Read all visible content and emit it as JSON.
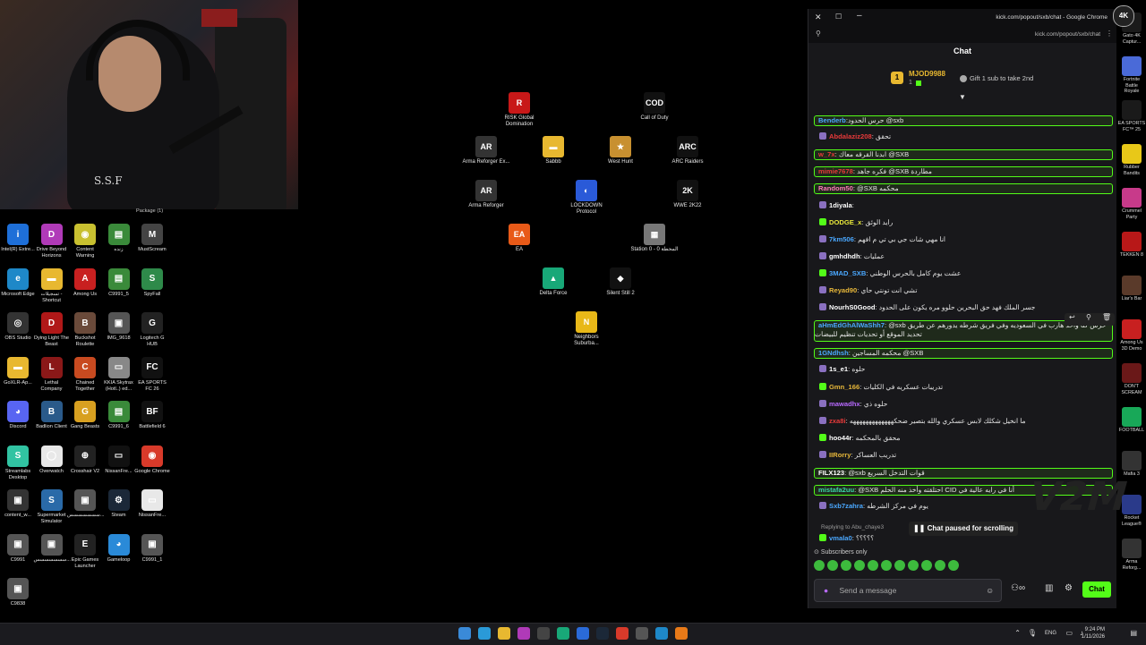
{
  "webcam": {
    "shirt_text": "S.S.F"
  },
  "desktop": {
    "package_label": "Package (1)",
    "icons": [
      {
        "label": "Intel(R) Extre...",
        "color": "#1e6fd8",
        "glyph": "i"
      },
      {
        "label": "Drive Beyond Horizons",
        "color": "#b03ab8",
        "glyph": "D"
      },
      {
        "label": "Content Warning",
        "color": "#c8c030",
        "glyph": "◉"
      },
      {
        "label": "زنده",
        "color": "#3a8a3a",
        "glyph": "▤"
      },
      {
        "label": "MustScream",
        "color": "#444444",
        "glyph": "M"
      },
      {
        "label": "Microsoft Edge",
        "color": "#1e88c8",
        "glyph": "e"
      },
      {
        "label": "تسجيلات - Shortcut",
        "color": "#e8b830",
        "glyph": "▬"
      },
      {
        "label": "Among Us",
        "color": "#c82020",
        "glyph": "A"
      },
      {
        "label": "C9991_5",
        "color": "#3a8a3a",
        "glyph": "▤"
      },
      {
        "label": "SpyFall",
        "color": "#2e8a4a",
        "glyph": "S"
      },
      {
        "label": "OBS Studio",
        "color": "#333333",
        "glyph": "◎"
      },
      {
        "label": "Dying Light The Beast",
        "color": "#b01818",
        "glyph": "D"
      },
      {
        "label": "Buckshot Roulette",
        "color": "#6a4a3a",
        "glyph": "B"
      },
      {
        "label": "IMG_9618",
        "color": "#555555",
        "glyph": "▣"
      },
      {
        "label": "Logitech G HUB",
        "color": "#222222",
        "glyph": "G"
      },
      {
        "label": "GoXLR-Ap...",
        "color": "#e8b830",
        "glyph": "▬"
      },
      {
        "label": "Lethal Company",
        "color": "#8a1818",
        "glyph": "L"
      },
      {
        "label": "Chained Together",
        "color": "#c84a20",
        "glyph": "C"
      },
      {
        "label": "KKIA Skytrax (Hotl..) ed...",
        "color": "#888888",
        "glyph": "▭"
      },
      {
        "label": "EA SPORTS FC 26",
        "color": "#111111",
        "glyph": "FC"
      },
      {
        "label": "Discord",
        "color": "#5865f2",
        "glyph": "◕"
      },
      {
        "label": "Badlion Client",
        "color": "#2a5a8a",
        "glyph": "B"
      },
      {
        "label": "Gang Beasts",
        "color": "#d8a020",
        "glyph": "G"
      },
      {
        "label": "C9991_6",
        "color": "#3a8a3a",
        "glyph": "▤"
      },
      {
        "label": "Battlefield 6",
        "color": "#111111",
        "glyph": "BF"
      },
      {
        "label": "Streamlabs Desktop",
        "color": "#31c3a2",
        "glyph": "S"
      },
      {
        "label": "Overwatch",
        "color": "#e8e8e8",
        "glyph": "◯"
      },
      {
        "label": "Crosshair V2",
        "color": "#222222",
        "glyph": "⊕"
      },
      {
        "label": "NissanFre...",
        "color": "#111111",
        "glyph": "▭"
      },
      {
        "label": "Google Chrome",
        "color": "#d83a2a",
        "glyph": "◉"
      },
      {
        "label": "content_w...",
        "color": "#333333",
        "glyph": "▣"
      },
      {
        "label": "Supermarket Simulator",
        "color": "#2a6aa8",
        "glyph": "S"
      },
      {
        "label": "سسسسسسس...",
        "color": "#555555",
        "glyph": "▣"
      },
      {
        "label": "Steam",
        "color": "#1b2838",
        "glyph": "⚙"
      },
      {
        "label": "NissanFre...",
        "color": "#e8e8e8",
        "glyph": "▭"
      },
      {
        "label": "C9991",
        "color": "#555555",
        "glyph": "▣"
      },
      {
        "label": "سسسسسسس...",
        "color": "#555555",
        "glyph": "▣"
      },
      {
        "label": "Epic Games Launcher",
        "color": "#222222",
        "glyph": "E"
      },
      {
        "label": "Gameloop",
        "color": "#2a8ad8",
        "glyph": "◕"
      },
      {
        "label": "C9991_1",
        "color": "#555555",
        "glyph": "▣"
      },
      {
        "label": "C9838",
        "color": "#555555",
        "glyph": "▣"
      }
    ],
    "center_icons": [
      {
        "label": "RISK Global Domination",
        "color": "#c81818",
        "glyph": "R"
      },
      {
        "label": "Call of Duty",
        "color": "#111111",
        "glyph": "COD"
      },
      {
        "label": "Arma Reforger Ex...",
        "color": "#333333",
        "glyph": "AR"
      },
      {
        "label": "Sabbb",
        "color": "#e8b830",
        "glyph": "▬"
      },
      {
        "label": "West Hunt",
        "color": "#c89030",
        "glyph": "★"
      },
      {
        "label": "ARC Raiders",
        "color": "#111111",
        "glyph": "ARC"
      },
      {
        "label": "Arma Reforger",
        "color": "#333333",
        "glyph": "AR"
      },
      {
        "label": "LOCKDOWN Protocol",
        "color": "#2a5ad8",
        "glyph": "◐"
      },
      {
        "label": "WWE 2K22",
        "color": "#111111",
        "glyph": "2K"
      },
      {
        "label": "EA",
        "color": "#e85a18",
        "glyph": "EA"
      },
      {
        "label": "Station 0 - المحطة 0",
        "color": "#777777",
        "glyph": "▦"
      },
      {
        "label": "Delta Force",
        "color": "#18a878",
        "glyph": "▲"
      },
      {
        "label": "Silent Still 2",
        "color": "#111111",
        "glyph": "◆"
      },
      {
        "label": "Neighbors Suburba...",
        "color": "#e8b818",
        "glyph": "N"
      }
    ]
  },
  "chat": {
    "window_url_title": "kick.com/popout/sxb/chat - Google Chrome",
    "url": "kick.com/popout/sxb/chat",
    "title": "Chat",
    "leader": {
      "rank": "1",
      "name": "MJOD9988",
      "count": "1",
      "gift_text": "Gift 1 sub to take 2nd"
    },
    "messages": [
      {
        "user": "Benderb",
        "text": ":حرس الحدود @sxb",
        "color": "#4aa8ff",
        "hl": true
      },
      {
        "user": "Abdalaziz208",
        "text": ": تحقق",
        "color": "#e83a3a",
        "hl": false
      },
      {
        "user": "w_7x",
        "text": ": ابدنا القرقه معاك @SXB",
        "color": "#e83a3a",
        "hl": true
      },
      {
        "user": "mimie7678",
        "text": ": فكره جاهد @SXB مطاردة",
        "color": "#e83a3a",
        "hl": true
      },
      {
        "user": "Random50",
        "text": ": @SXB محكمه",
        "color": "#ff7ab8",
        "hl": true
      },
      {
        "user": "1diyala",
        "text": ":",
        "color": "#ffffff",
        "hl": false
      },
      {
        "user": "DODGE_x",
        "text": ": رايد الوئق",
        "color": "#e8e83a",
        "hl": false
      },
      {
        "user": "7km506",
        "text": ": انا مهي شات جي بي تي م افهم",
        "color": "#4aa8ff",
        "hl": false
      },
      {
        "user": "gmhdhdh",
        "text": ": عمليات",
        "color": "#ffffff",
        "hl": false
      },
      {
        "user": "3MAD_SXB",
        "text": ": عشت يوم كامل بالحرس الوطني",
        "color": "#4aa8ff",
        "hl": false
      },
      {
        "user": "Reyad90",
        "text": ": تشي انت تونتي حاي",
        "color": "#e8b83a",
        "hl": false
      },
      {
        "user": "NourhS0Good",
        "text": ": جسر الملك فهد حق البحرين حلوو مره يكون على الحدود",
        "color": "#ffffff",
        "hl": false
      },
      {
        "user": "aHmEdGhAlWaShh7",
        "text": ": @sxb حرس كنا واحد هارب في السعوديه وفي فريق شرطه يدورهم عن طريق تحديد الموقع أو تحديات تنظيم للبيضات",
        "color": "#4aa8ff",
        "hl": true
      },
      {
        "user": "1GNdhsh",
        "text": ": محكمه المساجين @SXB",
        "color": "#4aa8ff",
        "hl": true
      },
      {
        "user": "1s_e1",
        "text": ": حلوه",
        "color": "#ffffff",
        "hl": false
      },
      {
        "user": "Gmn_166",
        "text": ": تدريبات عسكريه في الكليات",
        "color": "#e8b83a",
        "hl": false
      },
      {
        "user": "mawadhx",
        "text": ": حلوه ذي",
        "color": "#b86aff",
        "hl": false
      },
      {
        "user": "zxa8i",
        "text": ": ما انخيل شكلك لابس عسكري والله بتصير ضحكهههههههههههههه",
        "color": "#e83a3a",
        "hl": false
      },
      {
        "user": "hoo44r",
        "text": ": محقق بالمحكمه",
        "color": "#ffffff",
        "hl": false
      },
      {
        "user": "IIRorry",
        "text": ": تدريب العساكر",
        "color": "#e8b83a",
        "hl": false
      },
      {
        "user": "FILX123",
        "text": ": @sxb قوات التدخل السريع",
        "color": "#ffffff",
        "hl": true
      },
      {
        "user": "mistafa2uu",
        "text": ": @SXB احتلقته وأخذ منه الحلم CID أنا في رايه عالية في",
        "color": "#3ad8a8",
        "hl": true
      },
      {
        "user": "Sxb7zahra",
        "text": ": يوم في مركز الشرطه",
        "color": "#4aa8ff",
        "hl": false
      }
    ],
    "reply_line": "Replying to Abu_chaye3",
    "last_user": "vmala0",
    "last_text": ": ؟؟؟؟؟",
    "paused_text": "Chat paused for scrolling",
    "subs_only": "Subscribers only",
    "input_placeholder": "Send a message",
    "chat_button": "Chat"
  },
  "right_strip": [
    {
      "label": "Gato 4K Captur...",
      "color": "#1a1a1a"
    },
    {
      "label": "Fortnite Battle Royale",
      "color": "#4a6ad8"
    },
    {
      "label": "EA SPORTS FC™ 25",
      "color": "#1a1a1a"
    },
    {
      "label": "Rubber Bandits",
      "color": "#e8c818"
    },
    {
      "label": "Crummel Party",
      "color": "#c83a8a"
    },
    {
      "label": "TEKKEN 8",
      "color": "#b81818"
    },
    {
      "label": "Liar's Bar",
      "color": "#5a3a2a"
    },
    {
      "label": "Among Us 3D Demo",
      "color": "#c82020"
    },
    {
      "label": "DON'T SCREAM",
      "color": "#6a1818"
    },
    {
      "label": "FOOTBALL",
      "color": "#18a858"
    },
    {
      "label": "Mafia 3",
      "color": "#333333"
    },
    {
      "label": "Rocket League®",
      "color": "#2a3a8a"
    },
    {
      "label": "Arma Reforg...",
      "color": "#333333"
    }
  ],
  "taskbar": {
    "lang": "ENG",
    "time": "9:24 PM",
    "date": "1/11/2026",
    "apps": [
      "#3a8ad8",
      "#2a9ad8",
      "#e8b830",
      "#b03ab8",
      "#444444",
      "#18a878",
      "#2a6ad8",
      "#1b2838",
      "#d83a2a",
      "#555555",
      "#1e88c8",
      "#e87a18"
    ]
  },
  "watermark": "V2M"
}
